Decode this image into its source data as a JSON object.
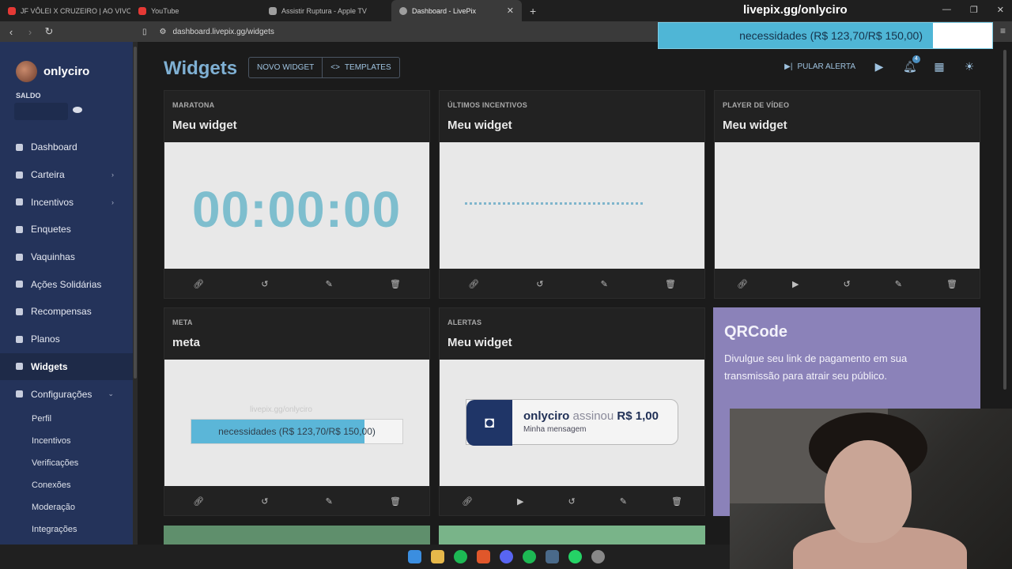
{
  "browser": {
    "tabs": [
      {
        "label": "JF VÔLEI X CRUZEIRO | AO VIVO E COM IMAGEM",
        "color": "#e53935"
      },
      {
        "label": "YouTube",
        "color": "#e53935"
      },
      {
        "label": "Assistir Ruptura - Apple TV",
        "color": "#9e9e9e"
      },
      {
        "label": "Dashboard - LivePix",
        "color": "#9e9e9e",
        "active": true
      }
    ],
    "url": "dashboard.livepix.gg/widgets"
  },
  "overlay": {
    "title": "livepix.gg/onlyciro",
    "goal_text": "necessidades (R$ 123,70/R$ 150,00)",
    "progress": 0.82
  },
  "sidebar": {
    "username": "onlyciro",
    "saldo_label": "SALDO",
    "items": [
      {
        "label": "Dashboard",
        "icon": "dashboard-icon"
      },
      {
        "label": "Carteira",
        "icon": "wallet-icon",
        "expandable": true
      },
      {
        "label": "Incentivos",
        "icon": "incentives-icon",
        "expandable": true
      },
      {
        "label": "Enquetes",
        "icon": "poll-icon"
      },
      {
        "label": "Vaquinhas",
        "icon": "piggy-icon"
      },
      {
        "label": "Ações Solidárias",
        "icon": "heart-icon"
      },
      {
        "label": "Recompensas",
        "icon": "gift-icon"
      },
      {
        "label": "Planos",
        "icon": "plans-icon"
      },
      {
        "label": "Widgets",
        "icon": "widgets-icon",
        "active": true
      },
      {
        "label": "Configurações",
        "icon": "gear-icon",
        "expandable": true
      }
    ],
    "subitems": [
      "Perfil",
      "Incentivos",
      "Verificações",
      "Conexões",
      "Moderação",
      "Integrações"
    ]
  },
  "main": {
    "title": "Widgets",
    "novo_widget": "NOVO WIDGET",
    "templates": "TEMPLATES",
    "pular_alerta": "PULAR ALERTA",
    "notification_count": "4"
  },
  "widgets": [
    {
      "category": "MARATONA",
      "name": "Meu widget",
      "timer": "00:00:00"
    },
    {
      "category": "ÚLTIMOS INCENTIVOS",
      "name": "Meu widget"
    },
    {
      "category": "PLAYER DE VÍDEO",
      "name": "Meu widget"
    },
    {
      "category": "META",
      "name": "meta",
      "url": "livepix.gg/onlyciro",
      "goal_text": "necessidades (R$ 123,70/R$ 150,00)",
      "progress": 0.82
    },
    {
      "category": "ALERTAS",
      "name": "Meu widget",
      "alert_user": "onlyciro",
      "alert_action": "assinou",
      "alert_amount": "R$ 1,00",
      "alert_message": "Minha mensagem"
    }
  ],
  "qrcode": {
    "title": "QRCode",
    "description": "Divulgue seu link de pagamento em sua transmissão para atrair seu público."
  }
}
